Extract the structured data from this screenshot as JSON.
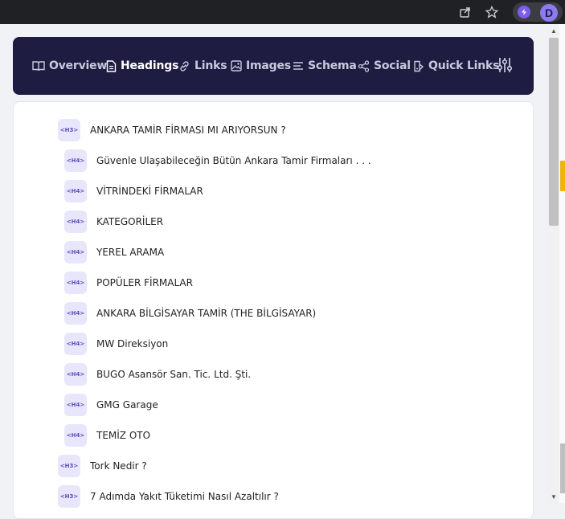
{
  "nav": {
    "items": [
      {
        "label": "Overview",
        "icon": "book-icon",
        "active": false
      },
      {
        "label": "Headings",
        "icon": "document-icon",
        "active": true
      },
      {
        "label": "Links",
        "icon": "link-icon",
        "active": false
      },
      {
        "label": "Images",
        "icon": "image-icon",
        "active": false
      },
      {
        "label": "Schema",
        "icon": "list-icon",
        "active": false
      },
      {
        "label": "Social",
        "icon": "share-icon",
        "active": false
      },
      {
        "label": "Quick Links",
        "icon": "quick-links-icon",
        "active": false
      }
    ],
    "settings_icon": "sliders-icon"
  },
  "extensions": {
    "letter": "D"
  },
  "headings": [
    {
      "level": "<H3>",
      "text": "ANKARA TAMİR FİRMASI MI ARIYORSUN ?"
    },
    {
      "level": "<H4>",
      "text": "Güvenle Ulaşabileceğin Bütün Ankara Tamir Firmaları . . ."
    },
    {
      "level": "<H4>",
      "text": "VİTRİNDEKİ FİRMALAR"
    },
    {
      "level": "<H4>",
      "text": "KATEGORİLER"
    },
    {
      "level": "<H4>",
      "text": "YEREL ARAMA"
    },
    {
      "level": "<H4>",
      "text": "POPÜLER FİRMALAR"
    },
    {
      "level": "<H4>",
      "text": "ANKARA BİLGİSAYAR TAMİR (THE BİLGİSAYAR)"
    },
    {
      "level": "<H4>",
      "text": "MW Direksiyon"
    },
    {
      "level": "<H4>",
      "text": "BUGO Asansör San. Tic. Ltd. Şti."
    },
    {
      "level": "<H4>",
      "text": "GMG Garage"
    },
    {
      "level": "<H4>",
      "text": "TEMİZ OTO"
    },
    {
      "level": "<H3>",
      "text": "Tork Nedir ?"
    },
    {
      "level": "<H3>",
      "text": "7 Adımda Yakıt Tüketimi Nasıl Azaltılır ?"
    }
  ],
  "colors": {
    "navbar_bg": "#1f1c42",
    "badge_bg": "#e7e6fb",
    "badge_text": "#5b4bc4",
    "accent_ext": "#7c5cf0"
  }
}
